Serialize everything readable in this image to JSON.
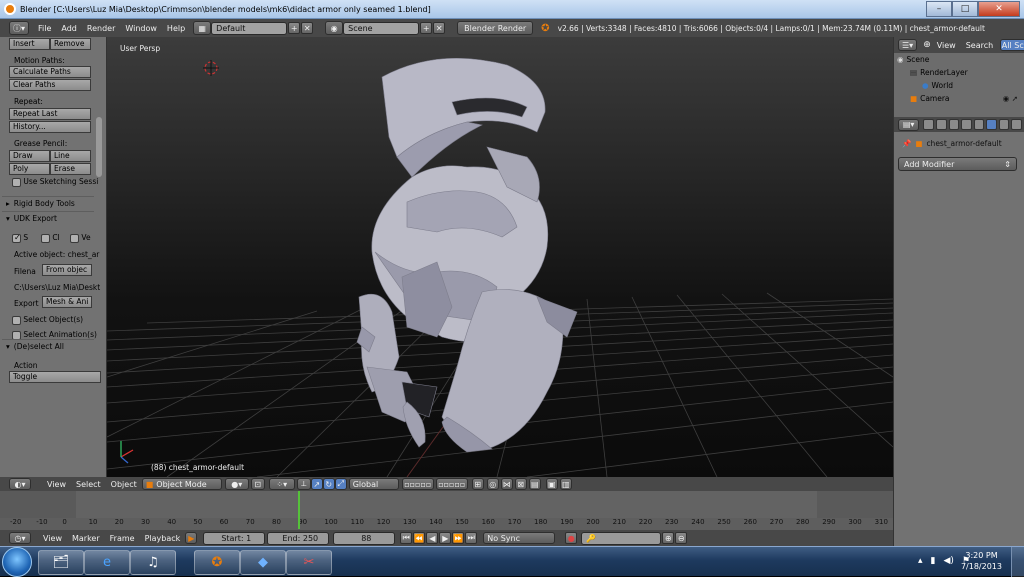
{
  "titlebar": {
    "title": "Blender  [C:\\Users\\Luz Mia\\Desktop\\Crimmson\\blender models\\mk6\\didact armor only seamed 1.blend]"
  },
  "info_header": {
    "menus": [
      "File",
      "Add",
      "Render",
      "Window",
      "Help"
    ],
    "screen_layout": "Default",
    "scene": "Scene",
    "render_engine": "Blender Render",
    "stats": "v2.66 | Verts:3348 | Faces:4810 | Tris:6066 | Objects:0/4 | Lamps:0/1 | Mem:23.74M (0.11M) | chest_armor-default"
  },
  "toolshelf": {
    "insert_label": "Insert",
    "remove_label": "Remove",
    "motion_paths_heading": "Motion Paths:",
    "calculate_paths_label": "Calculate Paths",
    "clear_paths_label": "Clear Paths",
    "repeat_heading": "Repeat:",
    "repeat_last_label": "Repeat Last",
    "history_label": "History...",
    "grease_pencil_heading": "Grease Pencil:",
    "draw_label": "Draw",
    "line_label": "Line",
    "poly_label": "Poly",
    "erase_label": "Erase",
    "use_sketching_label": "Use Sketching Sessi",
    "rigid_body_label": "Rigid Body Tools",
    "udk_export_label": "UDK Export",
    "chk_s_label": "S",
    "chk_c_label": "Cl",
    "chk_v_label": "Ve",
    "active_object_label": "Active object: chest_ar",
    "filename_label": "Filena",
    "filename_value": "From objec",
    "path_label": "C:\\Users\\Luz Mia\\Deskt",
    "export_label": "Export",
    "export_value": "Mesh & Ani",
    "select_objects_label": "Select Object(s)",
    "select_animations_label": "Select Animation(s)",
    "deselect_all_label": "(De)select All",
    "action_heading": "Action",
    "action_value": "Toggle"
  },
  "viewport": {
    "view_label": "User Persp",
    "status_label": "(88) chest_armor-default"
  },
  "view3d_header": {
    "menus": [
      "View",
      "Select",
      "Object"
    ],
    "mode": "Object Mode",
    "orientation": "Global"
  },
  "outliner": {
    "header_view": "View",
    "header_search": "Search",
    "header_filter": "All Sce",
    "rows": [
      "Scene",
      "RenderLayer",
      "World",
      "Camera"
    ]
  },
  "properties": {
    "object_name": "chest_armor-default",
    "add_modifier_label": "Add Modifier"
  },
  "timeline": {
    "ruler_ticks": [
      "-20",
      "-10",
      "0",
      "10",
      "20",
      "30",
      "40",
      "50",
      "60",
      "70",
      "80",
      "90",
      "100",
      "110",
      "120",
      "130",
      "140",
      "150",
      "160",
      "170",
      "180",
      "190",
      "200",
      "210",
      "220",
      "230",
      "240",
      "250",
      "260",
      "270",
      "280",
      "290",
      "300",
      "310"
    ],
    "current_frame_marker": 88,
    "menus": [
      "View",
      "Marker",
      "Frame",
      "Playback"
    ],
    "start_label": "Start: 1",
    "end_label": "End: 250",
    "current_frame": "88",
    "sync_label": "No Sync"
  },
  "taskbar": {
    "time": "3:20 PM",
    "date": "7/18/2013",
    "apps": [
      "windows-explorer-icon",
      "internet-explorer-icon",
      "itunes-icon",
      "blender-icon",
      "windows-media-icon",
      "snipping-tool-icon"
    ]
  },
  "colors": {
    "accent_blue": "#5680c2",
    "blender_orange": "#e87d0d",
    "timeline_marker": "#55c23a"
  }
}
